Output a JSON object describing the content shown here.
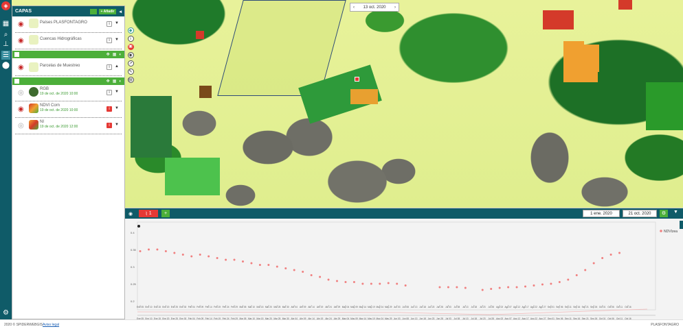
{
  "map": {
    "date_label": "13 oct. 2020",
    "prev_label": "‹",
    "next_label": "›"
  },
  "sidebar": {
    "title": "CAPAS",
    "add_label": "+ Añadir",
    "collapse_label": "◂",
    "layers_top": [
      {
        "name": "Países PLASFONTAGRO",
        "info": "i"
      },
      {
        "name": "Cuencas Hidrográficas",
        "info": "i"
      }
    ],
    "layers_mid": [
      {
        "name": "Parcelas de Muestreo",
        "info": "i"
      }
    ],
    "layers_bottom": [
      {
        "name": "RGB",
        "sub": "19 de oct. de 2020 10:00",
        "info": "i",
        "red": false
      },
      {
        "name": "NDVI Corn",
        "sub": "19 de oct. de 2020 10:00",
        "info": "i",
        "red": true
      },
      {
        "name": "NI",
        "sub": "19 de oct. de 2020 12:00",
        "info": "i",
        "red": true
      }
    ]
  },
  "chart_panel": {
    "tab_label": "1",
    "add_label": "+",
    "start_date": "1 ene. 2020",
    "end_date": "21 oct. 2020",
    "legend": "NDVIzea"
  },
  "chart_data": {
    "type": "scatter",
    "series": [
      {
        "name": "NDVIzea",
        "color": "#f08080"
      }
    ],
    "x_labels": [
      "Ene 05",
      "Ene 10",
      "Ene 15",
      "Ene 20",
      "Ene 25",
      "Ene 30",
      "Feb 04",
      "Feb 09",
      "Feb 14",
      "Feb 19",
      "Feb 24",
      "Feb 29",
      "Mar 05",
      "Mar 10",
      "Mar 15",
      "Mar 20",
      "Mar 25",
      "Mar 30",
      "Abr 04",
      "Abr 09",
      "Abr 14",
      "Abr 19",
      "Abr 24",
      "Abr 29",
      "May 04",
      "May 09",
      "May 14",
      "May 19",
      "May 24",
      "May 29",
      "Jun 03",
      "Jun 08",
      "Jun 13",
      "Jun 18",
      "Jun 23",
      "Jun 28",
      "Jul 03",
      "Jul 08",
      "Jul 13",
      "Jul 18",
      "Jul 23",
      "Jul 28",
      "Ago 02",
      "Ago 07",
      "Ago 12",
      "Ago 17",
      "Ago 22",
      "Ago 27",
      "Sep 01",
      "Sep 06",
      "Sep 11",
      "Sep 16",
      "Sep 21",
      "Sep 26",
      "Oct 01",
      "Oct 06",
      "Oct 11",
      "Oct 16"
    ],
    "y_ticks": [
      "0.4",
      "0.35",
      "0.3",
      "0.25",
      "0.2"
    ],
    "values": [
      0.345,
      0.35,
      0.35,
      0.345,
      0.34,
      0.335,
      0.33,
      0.335,
      0.33,
      0.325,
      0.32,
      0.32,
      0.315,
      0.31,
      0.305,
      0.305,
      0.3,
      0.295,
      0.29,
      0.285,
      0.275,
      0.27,
      0.262,
      0.258,
      0.255,
      0.255,
      0.25,
      0.25,
      0.25,
      0.252,
      0.25,
      0.245,
      null,
      null,
      null,
      0.24,
      0.24,
      0.24,
      0.238,
      null,
      0.232,
      0.235,
      0.238,
      0.24,
      0.24,
      0.242,
      0.245,
      0.248,
      0.25,
      0.255,
      0.262,
      0.275,
      0.29,
      0.31,
      0.325,
      0.335,
      0.34,
      null
    ],
    "ylim": [
      0.2,
      0.42
    ]
  },
  "footer": {
    "copyright": "2020 © SPIDERWEBGIS",
    "legal": "Aviso legal",
    "brand": "PLASFONTAGRO"
  }
}
